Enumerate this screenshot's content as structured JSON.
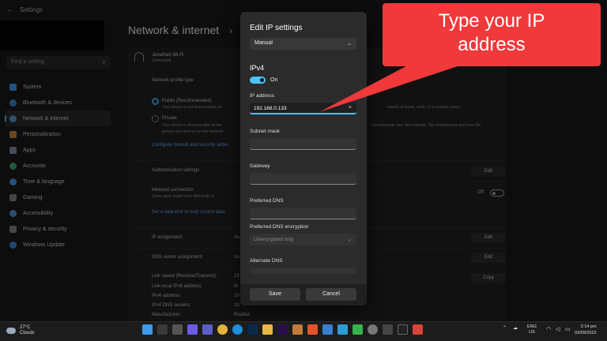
{
  "window": {
    "title": "Settings"
  },
  "search": {
    "placeholder": "Find a setting"
  },
  "sidebar": {
    "items": [
      {
        "label": "System",
        "color": "#4aa3ff"
      },
      {
        "label": "Bluetooth & devices",
        "color": "#3d8fe0"
      },
      {
        "label": "Network & internet",
        "color": "#5aa0d8",
        "active": true
      },
      {
        "label": "Personalization",
        "color": "#d98c4a"
      },
      {
        "label": "Apps",
        "color": "#8a9bb0"
      },
      {
        "label": "Accounts",
        "color": "#3fb27f"
      },
      {
        "label": "Time & language",
        "color": "#4aa3ff"
      },
      {
        "label": "Gaming",
        "color": "#8a8a8a"
      },
      {
        "label": "Accessibility",
        "color": "#5a9ae0"
      },
      {
        "label": "Privacy & security",
        "color": "#8a8a8a"
      },
      {
        "label": "Windows Update",
        "color": "#3d8fe0"
      }
    ]
  },
  "main": {
    "breadcrumb": "Network & internet",
    "chevron": "›",
    "connection": {
      "name": "Jonathan Wi-Fi",
      "status": "Connected"
    },
    "network_profile_type": "Network profile type",
    "public": {
      "label": "Public (Recommended)",
      "desc": "Your device is not discoverable on",
      "desc_right": "etwork at home, work, or in a public place"
    },
    "private": {
      "label": "Private",
      "desc": "Your device is discoverable on the",
      "desc2": "people and devices on the network.",
      "desc_right": "communicate over this network. You should know and trust the"
    },
    "firewall_link": "Configure firewall and security settin",
    "auth_settings": "Authentication settings",
    "metered": {
      "label": "Metered connection",
      "desc": "Some apps might work differently to",
      "state": "Off"
    },
    "data_limit_link": "Set a data limit to help control data",
    "ip_assignment": {
      "label": "IP assignment:",
      "value": "Au"
    },
    "dns_assignment": {
      "label": "DNS server assignment:",
      "value": "Au"
    },
    "edit_label": "Edit",
    "copy_label": "Copy",
    "props": [
      {
        "label": "Link speed (Receive/Transmit):",
        "value": "16"
      },
      {
        "label": "Link-local IPv6 address:",
        "value": "fe"
      },
      {
        "label": "IPv4 address:",
        "value": "19"
      },
      {
        "label": "IPv4 DNS servers:",
        "value": "19"
      },
      {
        "label": "Manufacturer:",
        "value": "Realtek"
      }
    ]
  },
  "dialog": {
    "title": "Edit IP settings",
    "mode": "Manual",
    "ipv4_heading": "IPv4",
    "ipv4_toggle_label": "On",
    "ip_address_label": "IP address",
    "ip_address_value": "192.168.0.133",
    "clear_icon": "×",
    "subnet_label": "Subnet mask",
    "subnet_value": "",
    "gateway_label": "Gateway",
    "gateway_value": "",
    "preferred_dns_label": "Preferred DNS",
    "preferred_dns_value": "",
    "dns_encryption_label": "Preferred DNS encryption",
    "dns_encryption_value": "Unencrypted only",
    "alternate_dns_label": "Alternate DNS",
    "save_label": "Save",
    "cancel_label": "Cancel"
  },
  "callout": {
    "line1": "Type your IP",
    "line2": "address",
    "color": "#f0393a"
  },
  "taskbar": {
    "weather_temp": "27°C",
    "weather_desc": "Clouds",
    "lang_top": "ENG",
    "lang_bottom": "US",
    "time": "2:14 pm",
    "date": "03/09/2022",
    "icons": [
      "start",
      "search",
      "task-view",
      "file-explorer",
      "teams",
      "chrome",
      "edge",
      "photoshop",
      "folder",
      "premiere",
      "app",
      "brave",
      "app2",
      "app3",
      "camtasia",
      "settings",
      "explorer2",
      "terminal",
      "app4"
    ]
  },
  "accent": "#4cc2ff"
}
